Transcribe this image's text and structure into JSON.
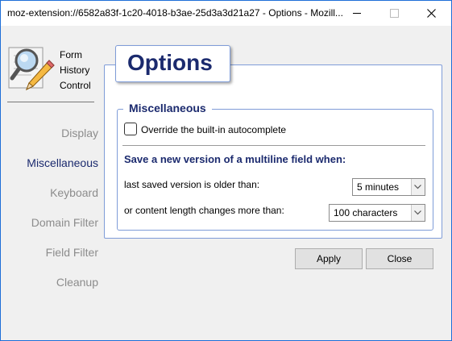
{
  "window": {
    "title": "moz-extension://6582a83f-1c20-4018-b3ae-25d3a3d21a27 - Options - Mozill..."
  },
  "sidebar": {
    "logo_lines": [
      "Form",
      "History",
      "Control"
    ],
    "items": [
      {
        "label": "Display",
        "active": false
      },
      {
        "label": "Miscellaneous",
        "active": true
      },
      {
        "label": "Keyboard",
        "active": false
      },
      {
        "label": "Domain Filter",
        "active": false
      },
      {
        "label": "Field Filter",
        "active": false
      },
      {
        "label": "Cleanup",
        "active": false
      }
    ]
  },
  "main": {
    "header": "Options",
    "group_title": "Miscellaneous",
    "override_checkbox": {
      "label": "Override the built-in autocomplete",
      "checked": false
    },
    "section_heading": "Save a new version of a multiline field when:",
    "rows": [
      {
        "label": "last saved version is older than:",
        "value": "5 minutes"
      },
      {
        "label": "or content length changes more than:",
        "value": "100 characters"
      }
    ]
  },
  "buttons": {
    "apply": "Apply",
    "close": "Close"
  },
  "colors": {
    "accent": "#1b2a6e",
    "border": "#7f9cd8",
    "inactive_nav": "#8c8c8c"
  },
  "icons": [
    "form-history-logo-icon",
    "close-icon",
    "minimize-icon",
    "maximize-icon",
    "chevron-down-icon"
  ]
}
